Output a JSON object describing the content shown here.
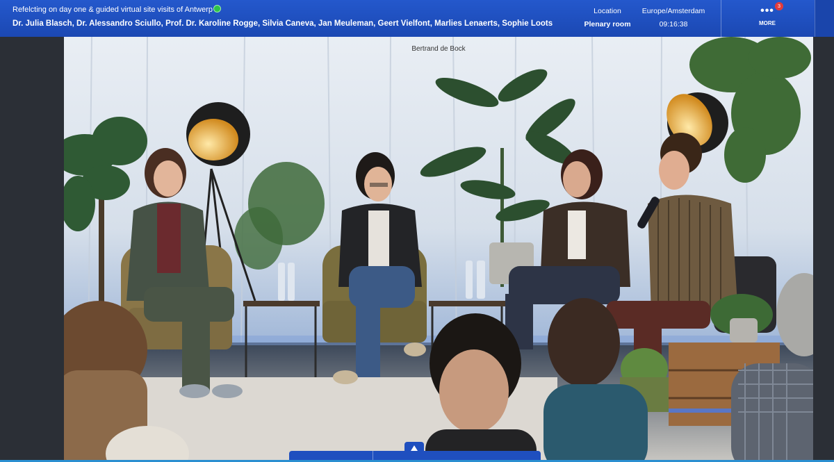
{
  "header": {
    "session_title": "Refelcting on day one & guided virtual site visits of Antwerp",
    "speakers": "Dr. Julia Blasch, Dr. Alessandro Sciullo, Prof. Dr. Karoline Rogge, Silvia Caneva, Jan Meuleman, Geert Vielfont, Marlies Lenaerts, Sophie Loots",
    "location_label": "Location",
    "location_value": "Plenary room",
    "timezone_label": "Europe/Amsterdam",
    "time_value": "09:16:38",
    "more_label": "MORE",
    "more_icon": "•••",
    "notification_count": "3"
  },
  "video": {
    "presenter_name": "Bertrand de Bock"
  },
  "colors": {
    "topbar": "#1f4fbf",
    "live_indicator": "#2ec24a",
    "badge": "#e23b3b"
  }
}
